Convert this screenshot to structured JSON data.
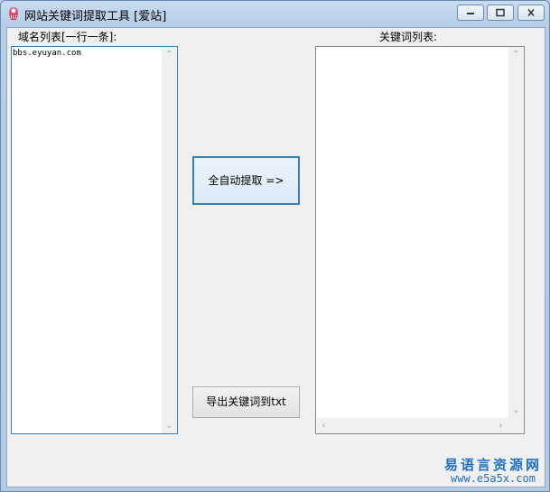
{
  "window": {
    "title": "网站关键词提取工具 [爱站]",
    "icon": "cupcake-app-icon"
  },
  "domains": {
    "label": "域名列表[一行一条]:",
    "value": "bbs.eyuyan.com"
  },
  "keywords": {
    "label": "关键词列表:",
    "value": ""
  },
  "buttons": {
    "extract": "全自动提取 =>",
    "export": "导出关键词到txt"
  },
  "watermark": {
    "name": "易语言资源网",
    "url": "www.e5a5x.com"
  },
  "colors": {
    "titlebar": "#c9dcf1",
    "focus_border": "#3c7fb1",
    "watermark": "#1e6fc8"
  }
}
